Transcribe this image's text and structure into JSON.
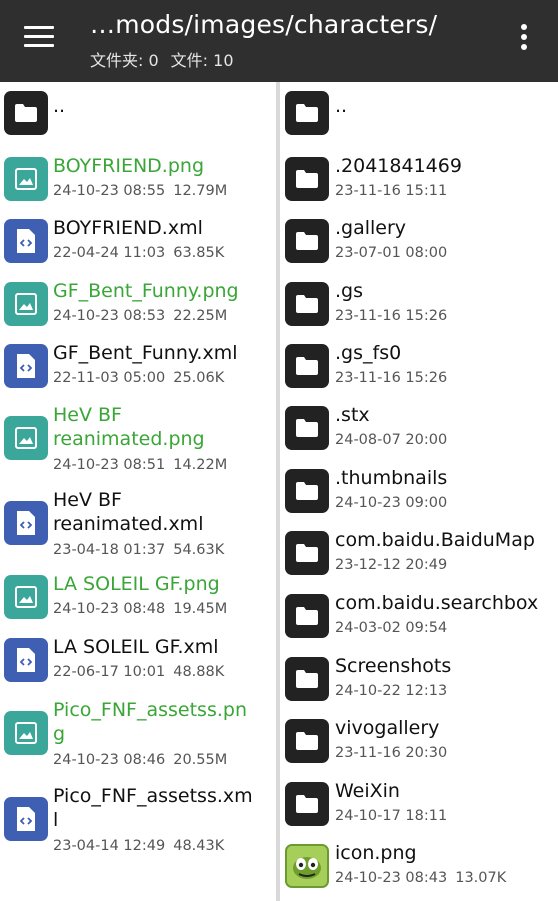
{
  "header": {
    "path": "…mods/images/characters/",
    "folders_label": "文件夹: 0",
    "files_label": "文件: 10"
  },
  "left_pane": {
    "items": [
      {
        "name": "..",
        "type": "folder",
        "date": "",
        "size": ""
      },
      {
        "name": "BOYFRIEND.png",
        "type": "image",
        "date": "24-10-23 08:55",
        "size": "12.79M"
      },
      {
        "name": "BOYFRIEND.xml",
        "type": "xml",
        "date": "22-04-24 11:03",
        "size": "63.85K"
      },
      {
        "name": "GF_Bent_Funny.png",
        "type": "image",
        "date": "24-10-23 08:53",
        "size": "22.25M"
      },
      {
        "name": "GF_Bent_Funny.xml",
        "type": "xml",
        "date": "22-11-03 05:00",
        "size": "25.06K"
      },
      {
        "name": "HeV BF\nreanimated.png",
        "type": "image",
        "date": "24-10-23 08:51",
        "size": "14.22M"
      },
      {
        "name": "HeV BF\nreanimated.xml",
        "type": "xml",
        "date": "23-04-18 01:37",
        "size": "54.63K"
      },
      {
        "name": "LA SOLEIL GF.png",
        "type": "image",
        "date": "24-10-23 08:48",
        "size": "19.45M"
      },
      {
        "name": "LA SOLEIL GF.xml",
        "type": "xml",
        "date": "22-06-17 10:01",
        "size": "48.88K"
      },
      {
        "name": "Pico_FNF_assetss.pn\ng",
        "type": "image",
        "date": "24-10-23 08:46",
        "size": "20.55M"
      },
      {
        "name": "Pico_FNF_assetss.xm\nl",
        "type": "xml",
        "date": "23-04-14 12:49",
        "size": "48.43K"
      }
    ]
  },
  "right_pane": {
    "items": [
      {
        "name": "..",
        "type": "folder",
        "date": "",
        "size": ""
      },
      {
        "name": ".2041841469",
        "type": "folder",
        "date": "23-11-16 15:11",
        "size": ""
      },
      {
        "name": ".gallery",
        "type": "folder",
        "date": "23-07-01 08:00",
        "size": ""
      },
      {
        "name": ".gs",
        "type": "folder",
        "date": "23-11-16 15:26",
        "size": ""
      },
      {
        "name": ".gs_fs0",
        "type": "folder",
        "date": "23-11-16 15:26",
        "size": ""
      },
      {
        "name": ".stx",
        "type": "folder",
        "date": "24-08-07 20:00",
        "size": ""
      },
      {
        "name": ".thumbnails",
        "type": "folder",
        "date": "24-10-23 09:00",
        "size": ""
      },
      {
        "name": "com.baidu.BaiduMap",
        "type": "folder",
        "date": "23-12-12 20:49",
        "size": ""
      },
      {
        "name": "com.baidu.searchbox",
        "type": "folder",
        "date": "24-03-02 09:54",
        "size": ""
      },
      {
        "name": "Screenshots",
        "type": "folder",
        "date": "24-10-22 12:13",
        "size": ""
      },
      {
        "name": "vivogallery",
        "type": "folder",
        "date": "23-11-16 20:30",
        "size": ""
      },
      {
        "name": "WeiXin",
        "type": "folder",
        "date": "24-10-17 18:11",
        "size": ""
      },
      {
        "name": "icon.png",
        "type": "thumb",
        "date": "24-10-23 08:43",
        "size": "13.07K"
      }
    ]
  },
  "colors": {
    "appbar": "#2f2f2f",
    "image_name": "#3aa637",
    "image_icon": "#3aa79a",
    "xml_icon": "#3f5fb3",
    "folder_icon": "#222222"
  },
  "icons": {
    "menu": "hamburger-menu-icon",
    "overflow": "more-vertical-icon",
    "folder": "folder-icon",
    "image": "image-file-icon",
    "xml": "code-file-icon"
  }
}
